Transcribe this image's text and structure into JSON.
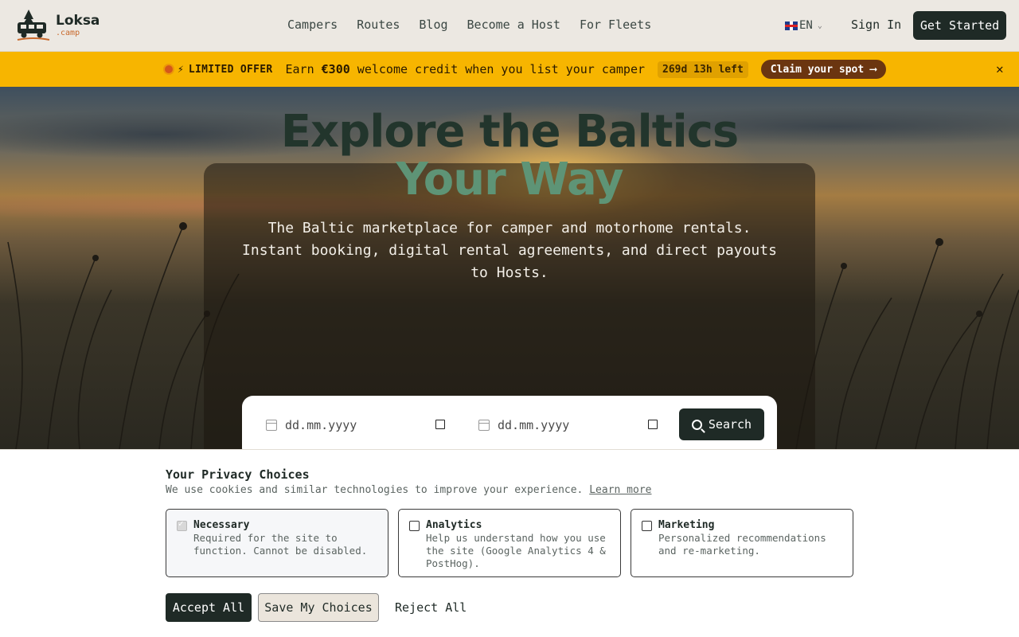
{
  "brand": {
    "name": "Loksa",
    "sub": ".camp"
  },
  "nav": {
    "links": [
      "Campers",
      "Routes",
      "Blog",
      "Become a Host",
      "For Fleets"
    ],
    "language": "EN",
    "sign_in": "Sign In",
    "get_started": "Get Started"
  },
  "offer": {
    "label": "LIMITED OFFER",
    "text_before": "Earn ",
    "amount": "€300",
    "text_after": " welcome credit when you list your camper",
    "countdown": "269d 13h left",
    "cta": "Claim your spot ⟶",
    "close_icon": "close-icon",
    "color": "#f7b500"
  },
  "hero": {
    "title_line1": "Explore the Baltics",
    "title_line2": "Your Way",
    "subtitle": "The Baltic marketplace for camper and motorhome rentals. Instant booking, digital rental agreements, and direct payouts to Hosts.",
    "search": {
      "start_placeholder": "dd.mm.yyyy",
      "end_placeholder": "dd.mm.yyyy",
      "button": "Search"
    }
  },
  "privacy": {
    "title": "Your Privacy Choices",
    "description": "We use cookies and similar technologies to improve your experience.",
    "learn_more": "Learn more",
    "options": [
      {
        "title": "Necessary",
        "description": "Required for the site to function. Cannot be disabled.",
        "checked": true,
        "disabled": true
      },
      {
        "title": "Analytics",
        "description": "Help us understand how you use the site (Google Analytics 4 & PostHog).",
        "checked": false,
        "disabled": false
      },
      {
        "title": "Marketing",
        "description": "Personalized recommendations and re-marketing.",
        "checked": false,
        "disabled": false
      }
    ],
    "accept_all": "Accept All",
    "save_choices": "Save My Choices",
    "reject_all": "Reject All"
  },
  "colors": {
    "primary": "#1f2a26",
    "accent_green": "#5e9476",
    "offer_bg": "#f7b500",
    "claim_bg": "#6b3510"
  }
}
